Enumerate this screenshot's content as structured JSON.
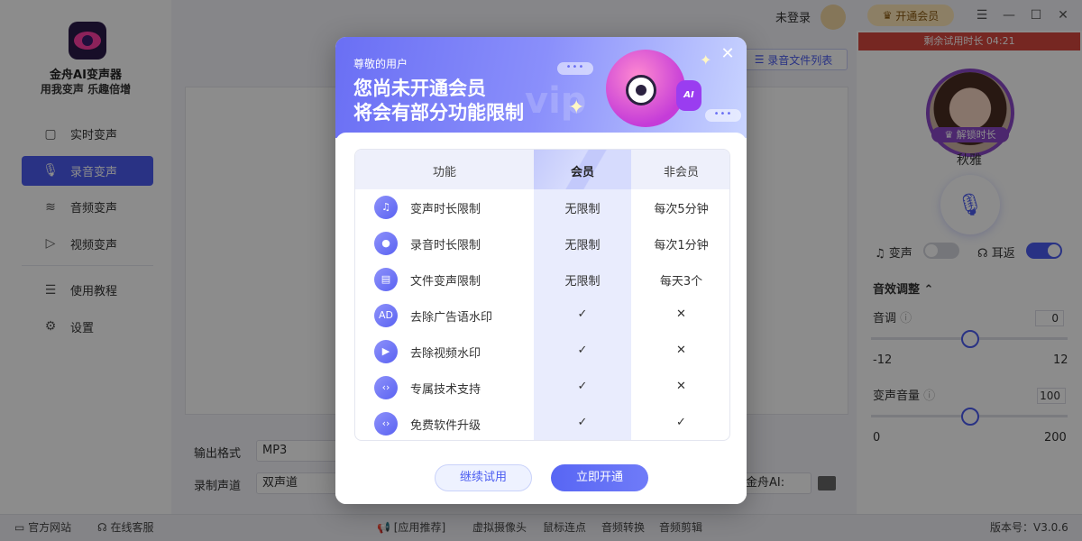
{
  "app": {
    "name": "金舟AI变声器",
    "slogan": "用我变声 乐趣倍增"
  },
  "sidebar": {
    "items": [
      {
        "label": "实时变声",
        "icon": "cube-icon",
        "active": false
      },
      {
        "label": "录音变声",
        "icon": "microphone-icon",
        "active": true
      },
      {
        "label": "音频变声",
        "icon": "audio-wave-icon",
        "active": false
      },
      {
        "label": "视频变声",
        "icon": "video-play-icon",
        "active": false
      }
    ],
    "bottom_items": [
      {
        "label": "使用教程",
        "icon": "book-icon"
      },
      {
        "label": "设置",
        "icon": "gear-icon"
      }
    ]
  },
  "topbar": {
    "login_status": "未登录",
    "vip_button": "开通会员",
    "trial_remaining": "剩余试用时长 04:21"
  },
  "main": {
    "file_list_button": "录音文件列表",
    "output_format_label": "输出格式",
    "output_format_value": "MP3",
    "channel_label": "录制声道",
    "channel_value": "双声道",
    "output_dir_value": "金舟AI:"
  },
  "right_panel": {
    "unlock_badge": "解锁时长",
    "voice_name": "秋雅",
    "voice_change_label": "变声",
    "voice_change_on": false,
    "ear_return_label": "耳返",
    "ear_return_on": true,
    "effects_title": "音效调整",
    "pitch": {
      "label": "音调",
      "value": "0",
      "min": "-12",
      "max": "12"
    },
    "volume": {
      "label": "变声音量",
      "value": "100",
      "min": "0",
      "max": "200"
    }
  },
  "footer": {
    "official_site": "官方网站",
    "online_service": "在线客服",
    "app_recommend": "[应用推荐]",
    "links": [
      "虚拟摄像头",
      "鼠标连点",
      "音频转换",
      "音频剪辑"
    ],
    "version": "版本号：V3.0.6"
  },
  "modal": {
    "greeting": "尊敬的用户",
    "title_line1": "您尚未开通会员",
    "title_line2": "将会有部分功能限制",
    "table": {
      "headers": [
        "功能",
        "会员",
        "非会员"
      ],
      "rows": [
        {
          "feature": "变声时长限制",
          "icon": "music-note-icon",
          "vip": "无限制",
          "non_vip": "每次5分钟"
        },
        {
          "feature": "录音时长限制",
          "icon": "microphone-icon",
          "vip": "无限制",
          "non_vip": "每次1分钟"
        },
        {
          "feature": "文件变声限制",
          "icon": "file-audio-icon",
          "vip": "无限制",
          "non_vip": "每天3个"
        },
        {
          "feature": "去除广告语水印",
          "icon": "ad-icon",
          "vip": "✓",
          "non_vip": "✕"
        },
        {
          "feature": "去除视频水印",
          "icon": "video-icon",
          "vip": "✓",
          "non_vip": "✕"
        },
        {
          "feature": "专属技术支持",
          "icon": "support-icon",
          "vip": "✓",
          "non_vip": "✕"
        },
        {
          "feature": "免费软件升级",
          "icon": "upgrade-icon",
          "vip": "✓",
          "non_vip": "✓"
        }
      ]
    },
    "continue_button": "继续试用",
    "open_button": "立即开通"
  }
}
